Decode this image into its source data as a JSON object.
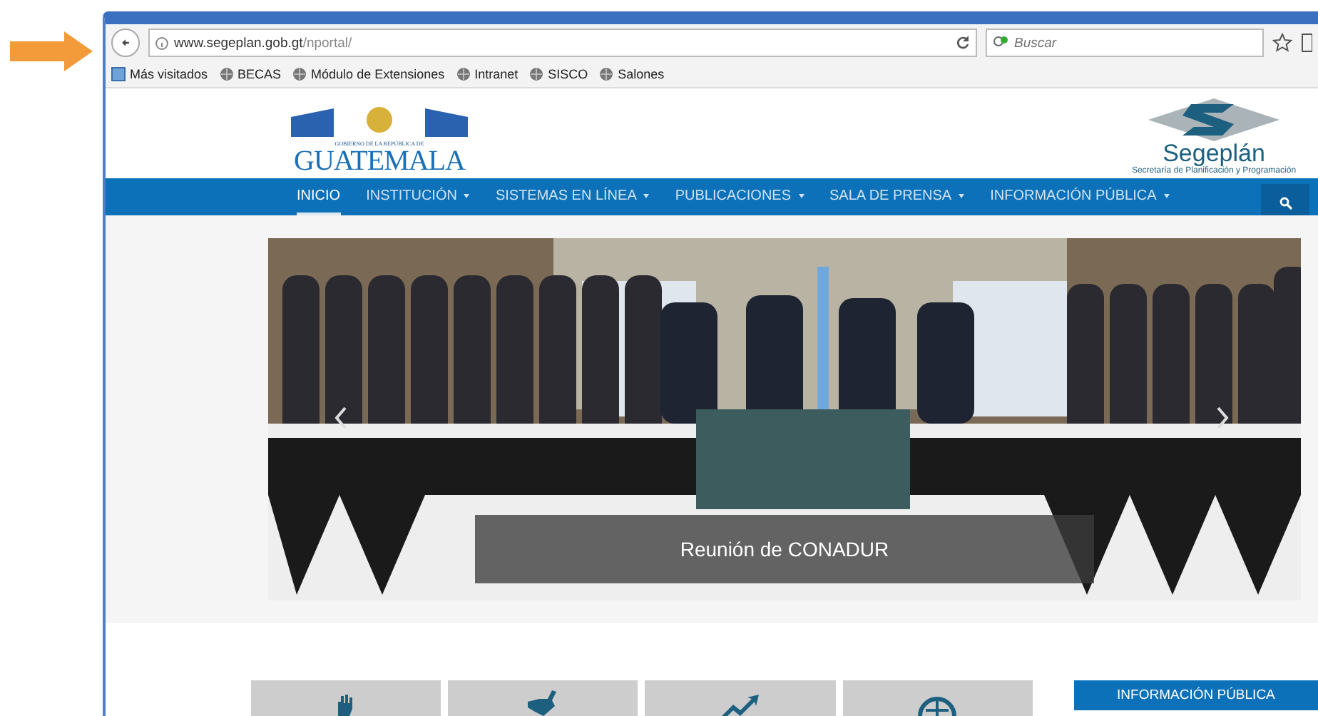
{
  "browser": {
    "url_host": "www.segeplan.gob.gt",
    "url_path": "/nportal/",
    "search": {
      "placeholder": "Buscar"
    },
    "bookmarks": [
      {
        "label": "Más visitados",
        "kind": "folder"
      },
      {
        "label": "BECAS",
        "kind": "globe"
      },
      {
        "label": "Módulo de Extensiones",
        "kind": "globe"
      },
      {
        "label": "Intranet",
        "kind": "globe"
      },
      {
        "label": "SISCO",
        "kind": "globe"
      },
      {
        "label": "Salones",
        "kind": "globe"
      }
    ]
  },
  "header": {
    "logo_left": {
      "small": "GOBIERNO DE LA REPÚBLICA DE",
      "big": "GUATEMALA"
    },
    "logo_right": {
      "name": "Segeplán",
      "tagline": "Secretaría de Planificación y Programación"
    }
  },
  "nav": [
    {
      "label": "INICIO",
      "selected": true,
      "dropdown": false
    },
    {
      "label": "INSTITUCIÓN",
      "selected": false,
      "dropdown": true
    },
    {
      "label": "SISTEMAS EN LÍNEA",
      "selected": false,
      "dropdown": true
    },
    {
      "label": "PUBLICACIONES",
      "selected": false,
      "dropdown": true
    },
    {
      "label": "SALA DE PRENSA",
      "selected": false,
      "dropdown": true
    },
    {
      "label": "INFORMACIÓN PÚBLICA",
      "selected": false,
      "dropdown": true
    }
  ],
  "slider": {
    "caption": "Reunión de CONADUR"
  },
  "tiles": [
    {
      "kind": "hands"
    },
    {
      "kind": "map"
    },
    {
      "kind": "growth"
    },
    {
      "kind": "globe"
    }
  ],
  "side_button": "INFORMACIÓN PÚBLICA"
}
